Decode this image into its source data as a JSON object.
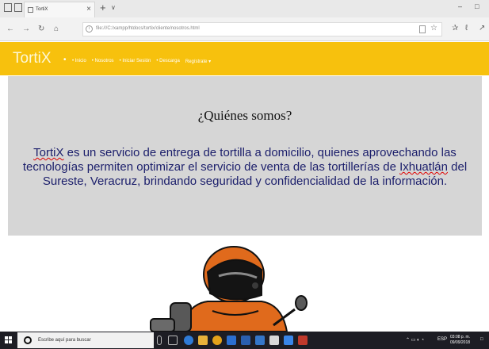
{
  "browser": {
    "tab_title": "TortiX",
    "tab_close": "×",
    "new_tab": "+",
    "tab_dropdown": "∨",
    "window": {
      "minimize": "–",
      "maximize": "□"
    },
    "nav": {
      "back": "←",
      "forward": "→",
      "refresh": "↻",
      "home": "⌂"
    },
    "url_info_glyph": "i",
    "url": "file:///C:/xampp/htdocs/tortix/cliente/nosotros.html",
    "favorite_glyph": "☆",
    "toolbar": {
      "favorites_glyph": "✰",
      "notes_glyph": "ℓ",
      "share_glyph": "↗"
    }
  },
  "site": {
    "brand": "TortiX",
    "nav_bullet": "•",
    "nav_links": [
      "• Inicio",
      "• Nosotros",
      "• Iniciar Sesión",
      "• Descarga",
      "Regístrate ▾"
    ],
    "hero": {
      "title": "¿Quiénes somos?",
      "paragraph": {
        "p1": "TortiX",
        "p2": " es un servicio de entrega de tortilla a domicilio, quienes aprovechando las tecnologías permiten optimizar el servicio de venta de las tortillerías de ",
        "p3": "Ixhuatlán",
        "p4": " del Sureste, Veracruz, brindando seguridad y confidencialidad de la información."
      }
    }
  },
  "taskbar": {
    "search_placeholder": "Escribe aquí para buscar",
    "tray_text": "ESP",
    "clock_time": "03:08 p. m.",
    "clock_date": "09/09/2018",
    "colors": {
      "edge": "#2f7bd6",
      "chrome": "#e3a21a",
      "store": "#2b6fd1",
      "mail": "#3a86e8"
    }
  }
}
